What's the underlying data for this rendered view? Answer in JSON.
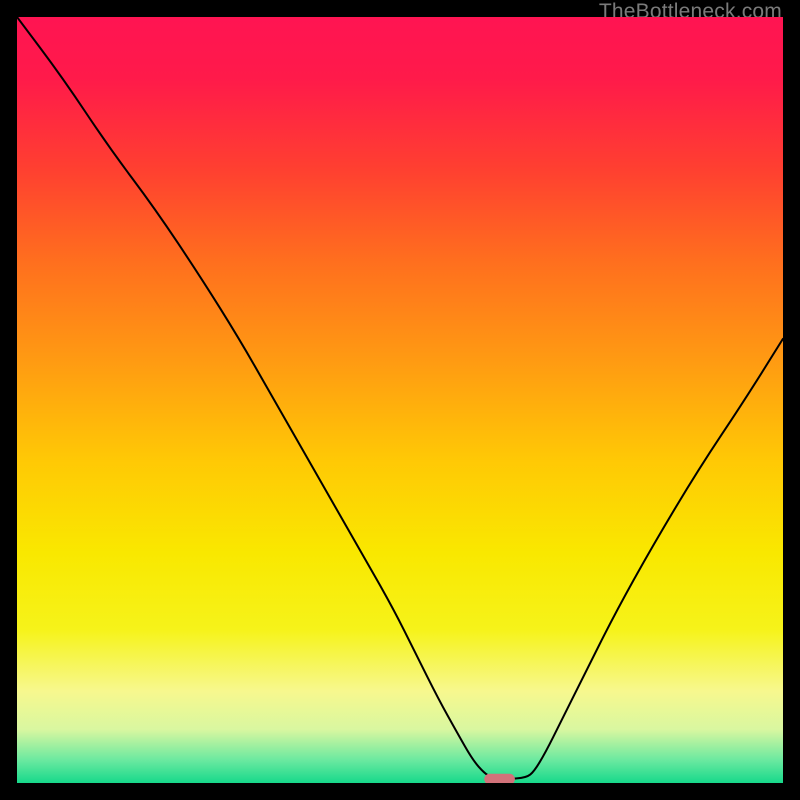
{
  "watermark": "TheBottleneck.com",
  "chart_data": {
    "type": "line",
    "title": "",
    "xlabel": "",
    "ylabel": "",
    "xlim": [
      0,
      100
    ],
    "ylim": [
      0,
      100
    ],
    "grid": false,
    "legend": false,
    "background_gradient": {
      "direction": "vertical",
      "stops": [
        {
          "offset": 0.0,
          "color": "#ff1452"
        },
        {
          "offset": 0.08,
          "color": "#ff1a4a"
        },
        {
          "offset": 0.2,
          "color": "#ff4030"
        },
        {
          "offset": 0.32,
          "color": "#ff6f1e"
        },
        {
          "offset": 0.45,
          "color": "#ff9b12"
        },
        {
          "offset": 0.58,
          "color": "#ffc905"
        },
        {
          "offset": 0.7,
          "color": "#f9e800"
        },
        {
          "offset": 0.8,
          "color": "#f6f31a"
        },
        {
          "offset": 0.88,
          "color": "#f7f88e"
        },
        {
          "offset": 0.93,
          "color": "#d9f7a0"
        },
        {
          "offset": 0.97,
          "color": "#6be9a0"
        },
        {
          "offset": 1.0,
          "color": "#17d98b"
        }
      ]
    },
    "series": [
      {
        "name": "bottleneck-curve",
        "color": "#000000",
        "stroke_width": 2,
        "x": [
          0,
          6,
          12,
          18,
          24,
          29,
          33,
          37,
          41,
          45,
          49,
          52,
          55,
          57.5,
          59.5,
          61,
          62,
          63,
          64,
          66.5,
          67.5,
          69,
          71,
          74,
          78,
          83,
          89,
          95,
          100
        ],
        "y": [
          100,
          92,
          83,
          75,
          66,
          58,
          51,
          44,
          37,
          30,
          23,
          17,
          11,
          6.5,
          3,
          1.3,
          0.7,
          0.5,
          0.5,
          0.7,
          1.5,
          4,
          8,
          14,
          22,
          31,
          41,
          50,
          58
        ]
      }
    ],
    "marker": {
      "name": "optimal-point",
      "shape": "rounded-rect",
      "x": 63.0,
      "y": 0.5,
      "width": 4.0,
      "height": 1.4,
      "color": "#d2727a"
    }
  }
}
